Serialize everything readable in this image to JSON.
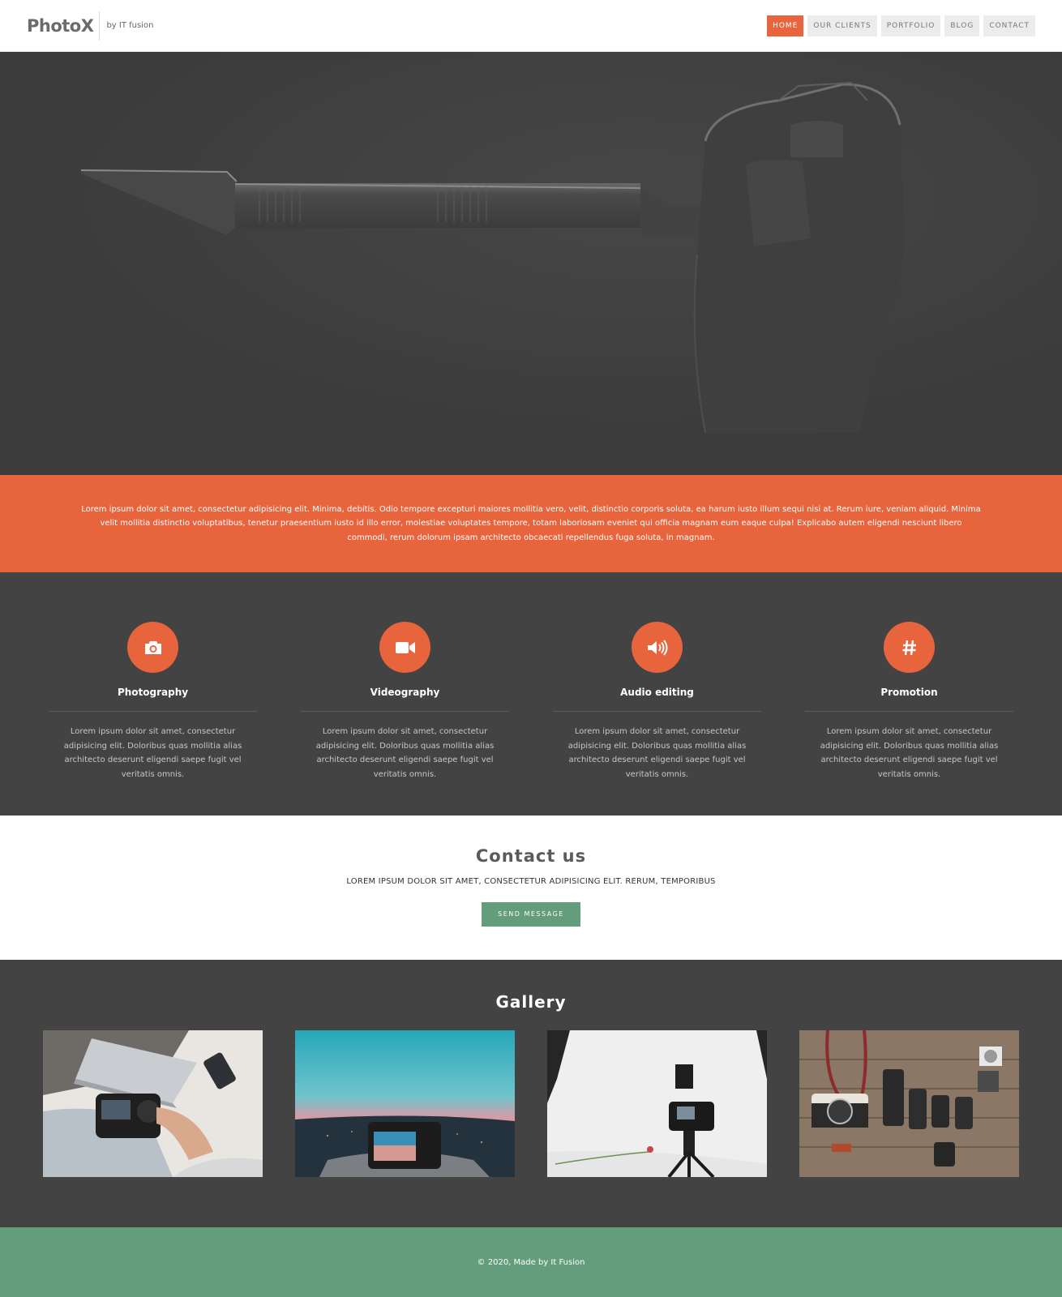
{
  "header": {
    "logo": "PhotoX",
    "tagline": "by IT fusion",
    "nav": [
      {
        "label": "HOME",
        "active": true
      },
      {
        "label": "OUR CLIENTS",
        "active": false
      },
      {
        "label": "PORTFOLIO",
        "active": false
      },
      {
        "label": "BLOG",
        "active": false
      },
      {
        "label": "CONTACT",
        "active": false
      }
    ]
  },
  "intro": {
    "text": "Lorem ipsum dolor sit amet, consectetur adipisicing elit. Minima, debitis. Odio tempore excepturi maiores mollitia vero, velit, distinctio corporis soluta, ea harum iusto illum sequi nisi at. Rerum iure, veniam aliquid. Minima velit mollitia distinctio voluptatibus, tenetur praesentium iusto id illo error, molestiae voluptates tempore, totam laboriosam eveniet qui officia magnam eum eaque culpa! Explicabo autem eligendi nesciunt libero commodi, rerum dolorum ipsam architecto obcaecati repellendus fuga soluta, in magnam."
  },
  "services": [
    {
      "icon": "camera-icon",
      "title": "Photography",
      "text": "Lorem ipsum dolor sit amet, consectetur adipisicing elit. Doloribus quas mollitia alias architecto deserunt eligendi saepe fugit vel veritatis omnis."
    },
    {
      "icon": "video-camera-icon",
      "title": "Videography",
      "text": "Lorem ipsum dolor sit amet, consectetur adipisicing elit. Doloribus quas mollitia alias architecto deserunt eligendi saepe fugit vel veritatis omnis."
    },
    {
      "icon": "volume-icon",
      "title": "Audio editing",
      "text": "Lorem ipsum dolor sit amet, consectetur adipisicing elit. Doloribus quas mollitia alias architecto deserunt eligendi saepe fugit vel veritatis omnis."
    },
    {
      "icon": "hashtag-icon",
      "title": "Promotion",
      "text": "Lorem ipsum dolor sit amet, consectetur adipisicing elit. Doloribus quas mollitia alias architecto deserunt eligendi saepe fugit vel veritatis omnis."
    }
  ],
  "contact": {
    "title": "Contact us",
    "subtitle": "LOREM IPSUM DOLOR SIT AMET, CONSECTETUR ADIPISICING ELIT. RERUM, TEMPORIBUS",
    "button": "SEND MESSAGE"
  },
  "gallery": {
    "title": "Gallery"
  },
  "footer": {
    "text": "© 2020, Made by It Fusion"
  },
  "colors": {
    "accent": "#e8643d",
    "dark": "#434343",
    "green": "#649d7c"
  }
}
